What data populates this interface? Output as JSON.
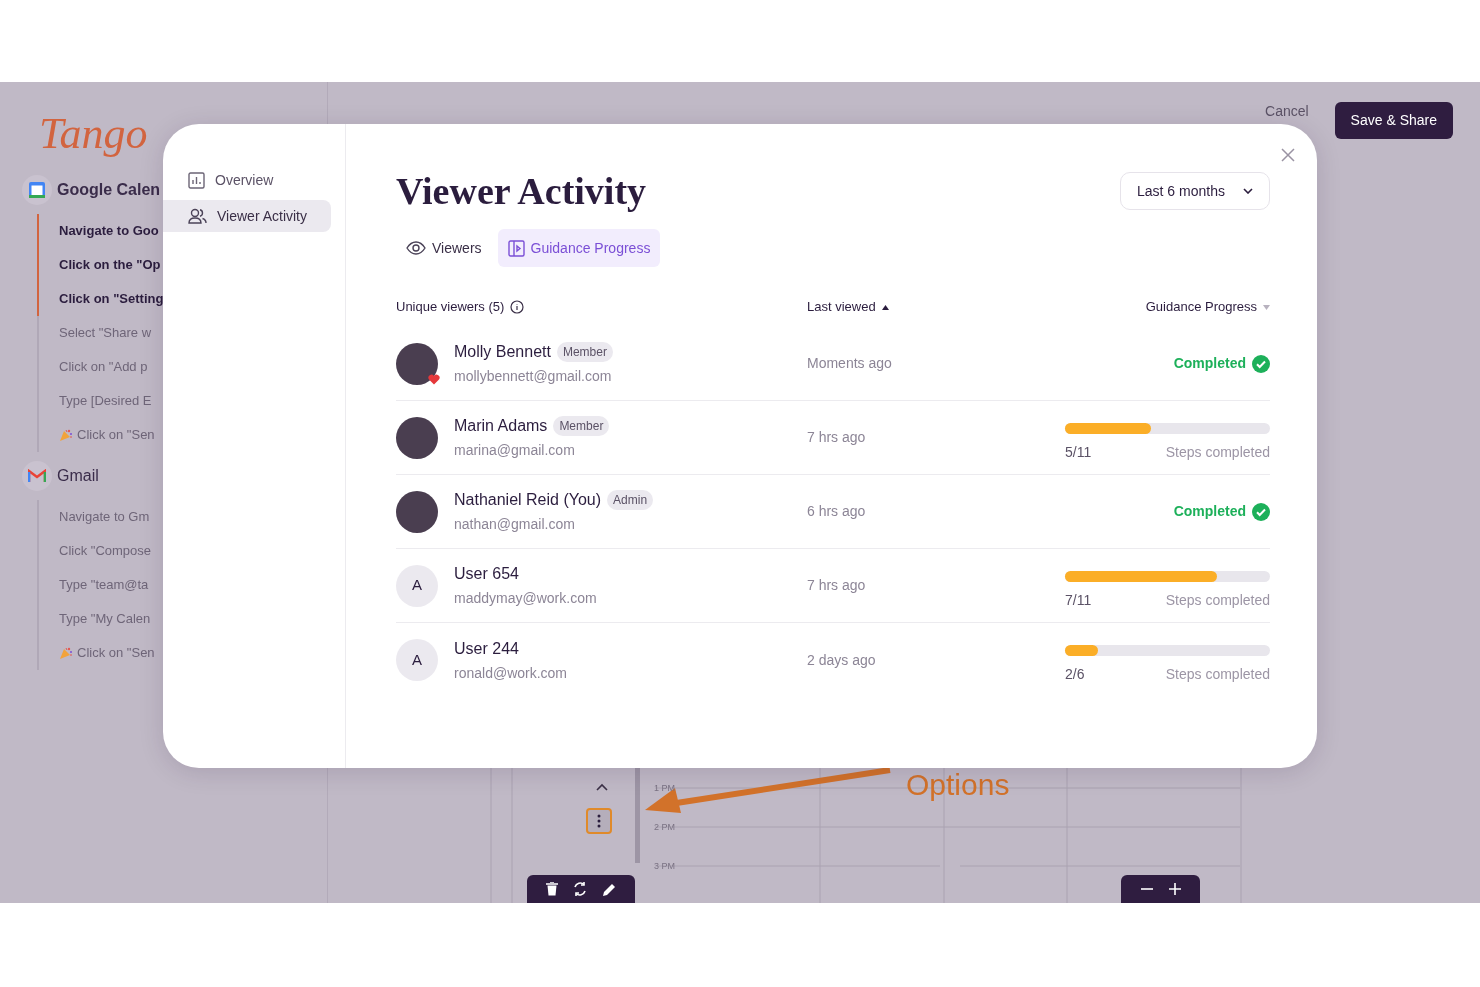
{
  "app": {
    "logo": "Tango",
    "cancel": "Cancel",
    "save": "Save & Share"
  },
  "workflow": [
    {
      "title": "Google Calen",
      "steps": [
        {
          "text": "Navigate to Goo",
          "done": true,
          "kind": "step"
        },
        {
          "text": "Click on the \"Op",
          "done": true,
          "kind": "step"
        },
        {
          "text": "Click on \"Setting",
          "done": true,
          "kind": "step"
        },
        {
          "text": "Select \"Share w",
          "done": false,
          "kind": "step"
        },
        {
          "text": "Click on \"Add p",
          "done": false,
          "kind": "step"
        },
        {
          "text": "Type [Desired E",
          "done": false,
          "kind": "step"
        },
        {
          "text": "Click on \"Sen",
          "done": false,
          "kind": "final"
        }
      ]
    },
    {
      "title": "Gmail",
      "steps": [
        {
          "text": "Navigate to Gm",
          "done": false,
          "kind": "step"
        },
        {
          "text": "Click \"Compose",
          "done": false,
          "kind": "step"
        },
        {
          "text": "Type \"team@ta",
          "done": false,
          "kind": "step"
        },
        {
          "text": "Type \"My Calen",
          "done": false,
          "kind": "step"
        },
        {
          "text": "Click on \"Sen",
          "done": false,
          "kind": "final"
        }
      ]
    }
  ],
  "canvas": {
    "annotation": "Options",
    "times": [
      "1 PM",
      "2 PM",
      "3 PM"
    ]
  },
  "modal": {
    "nav": [
      {
        "label": "Overview",
        "selected": false
      },
      {
        "label": "Viewer Activity",
        "selected": true
      }
    ],
    "title": "Viewer Activity",
    "range": "Last 6 months",
    "tabs": [
      {
        "label": "Viewers",
        "selected": false
      },
      {
        "label": "Guidance Progress",
        "selected": true
      }
    ],
    "columns": [
      {
        "label": "Unique viewers (5)",
        "kind": "info"
      },
      {
        "label": "Last viewed",
        "kind": "sorted"
      },
      {
        "label": "Guidance Progress",
        "kind": "sortable"
      }
    ],
    "rows": [
      {
        "name": "Molly Bennett",
        "role": "Member",
        "email": "mollybennett@gmail.com",
        "heart": true,
        "last_viewed": "Moments ago",
        "kind": "completed",
        "status": "Completed"
      },
      {
        "name": "Marin Adams",
        "role": "Member",
        "email": "marina@gmail.com",
        "heart": false,
        "last_viewed": "7 hrs ago",
        "kind": "progress",
        "level": 0.42,
        "count": "5/11",
        "status": "Steps completed"
      },
      {
        "name": "Nathaniel Reid (You)",
        "role": "Admin",
        "email": "nathan@gmail.com",
        "heart": false,
        "last_viewed": "6 hrs ago",
        "kind": "completed",
        "status": "Completed"
      },
      {
        "name": "User 654",
        "email": "maddymay@work.com",
        "initial": "A",
        "heart": false,
        "last_viewed": "7 hrs ago",
        "kind": "progress",
        "level": 0.74,
        "count": "7/11",
        "status": "Steps completed"
      },
      {
        "name": "User 244",
        "email": "ronald@work.com",
        "initial": "A",
        "heart": false,
        "last_viewed": "2 days ago",
        "kind": "progress",
        "level": 0.16,
        "count": "2/6",
        "status": "Steps completed"
      }
    ]
  }
}
